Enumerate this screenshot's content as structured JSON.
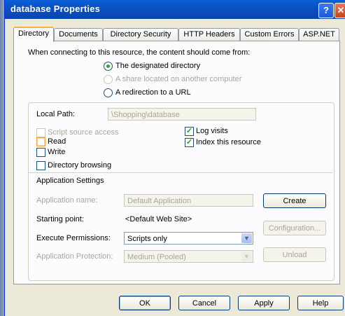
{
  "window": {
    "title": "database Properties",
    "help_glyph": "?",
    "close_glyph": "✕"
  },
  "tabs": [
    {
      "label": "Directory",
      "active": true
    },
    {
      "label": "Documents"
    },
    {
      "label": "Directory Security"
    },
    {
      "label": "HTTP Headers"
    },
    {
      "label": "Custom Errors"
    },
    {
      "label": "ASP.NET"
    }
  ],
  "content_source": {
    "prompt": "When connecting to this resource, the content should come from:",
    "options": [
      {
        "label": "The designated directory",
        "selected": true,
        "enabled": true
      },
      {
        "label": "A share located on another computer",
        "selected": false,
        "enabled": false
      },
      {
        "label": "A redirection to a URL",
        "selected": false,
        "enabled": true
      }
    ]
  },
  "local_path": {
    "label": "Local Path:",
    "value": "\\Shopping\\database"
  },
  "permissions": {
    "script_source_access": {
      "label": "Script source access",
      "checked": false,
      "enabled": false
    },
    "read": {
      "label": "Read",
      "checked": false,
      "enabled": true
    },
    "write": {
      "label": "Write",
      "checked": false,
      "enabled": true
    },
    "directory_browsing": {
      "label": "Directory browsing",
      "checked": false,
      "enabled": true
    },
    "log_visits": {
      "label": "Log visits",
      "checked": true,
      "enabled": true
    },
    "index_resource": {
      "label": "Index this resource",
      "checked": true,
      "enabled": true
    },
    "check_glyph": "✓"
  },
  "app_settings": {
    "section_title": "Application Settings",
    "app_name_label": "Application name:",
    "app_name_value": "Default Application",
    "create_button": "Create",
    "starting_point_label": "Starting point:",
    "starting_point_value": "<Default Web Site>",
    "configuration_button": "Configuration...",
    "execute_permissions_label": "Execute Permissions:",
    "execute_permissions_value": "Scripts only",
    "app_protection_label": "Application Protection:",
    "app_protection_value": "Medium (Pooled)",
    "unload_button": "Unload",
    "dropdown_glyph": "▼"
  },
  "footer": {
    "ok": "OK",
    "cancel": "Cancel",
    "apply": "Apply",
    "help": "Help"
  },
  "colors": {
    "titlebar": "#0a5fd8",
    "dialog_bg": "#ece9d8",
    "panel_bg": "#fcfcfe",
    "accent_check": "#21a121"
  }
}
